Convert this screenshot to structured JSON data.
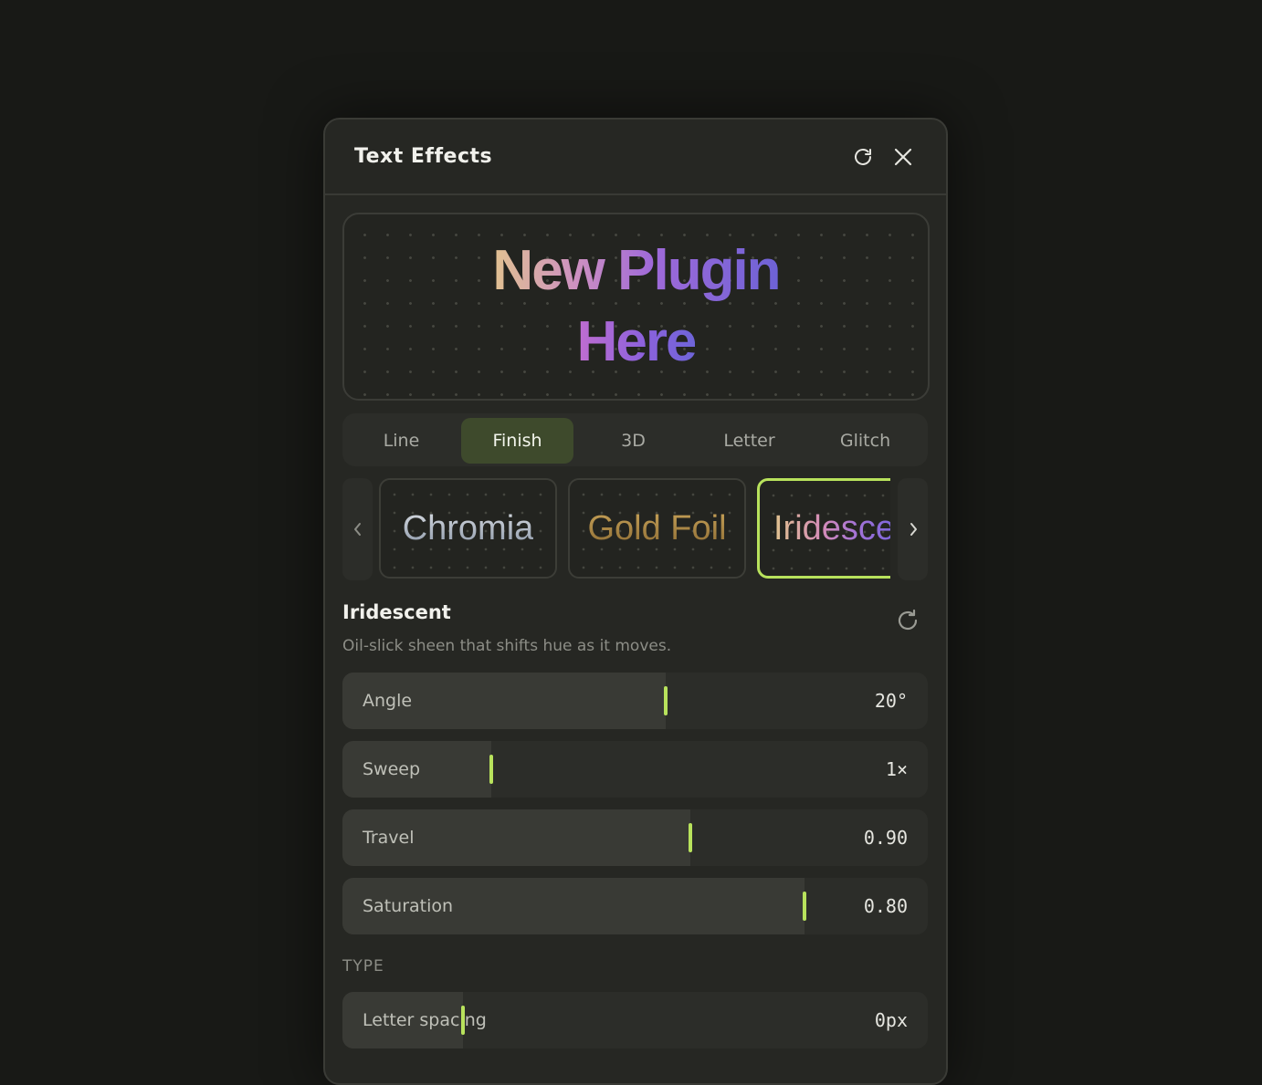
{
  "app": {
    "title": "Text Effects"
  },
  "header": {
    "reset_icon": "refresh-icon",
    "close_icon": "close-icon"
  },
  "preview": {
    "line1": "New Plugin",
    "line2": "Here"
  },
  "tabs": [
    {
      "label": "Line",
      "active": false
    },
    {
      "label": "Finish",
      "active": true
    },
    {
      "label": "3D",
      "active": false
    },
    {
      "label": "Letter",
      "active": false
    },
    {
      "label": "Glitch",
      "active": false
    }
  ],
  "presets": [
    {
      "label": "Chromia",
      "selected": false
    },
    {
      "label": "Gold Foil",
      "selected": false
    },
    {
      "label": "Iridesce",
      "selected": true
    }
  ],
  "effect": {
    "title": "Iridescent",
    "description": "Oil-slick sheen that shifts hue as it moves."
  },
  "sliders": [
    {
      "label": "Angle",
      "value": "20°",
      "level": 0.553
    },
    {
      "label": "Sweep",
      "value": "1×",
      "level": 0.254
    },
    {
      "label": "Travel",
      "value": "0.90",
      "level": 0.595
    },
    {
      "label": "Saturation",
      "value": "0.80",
      "level": 0.79
    }
  ],
  "type_section": {
    "label": "TYPE",
    "sliders": [
      {
        "label": "Letter spacing",
        "value": "0px",
        "level": 0.206
      }
    ]
  },
  "colors": {
    "accent": "#b8e25c",
    "active_tab": "#3e4a2c",
    "panel": "#262723",
    "background": "#181916"
  }
}
